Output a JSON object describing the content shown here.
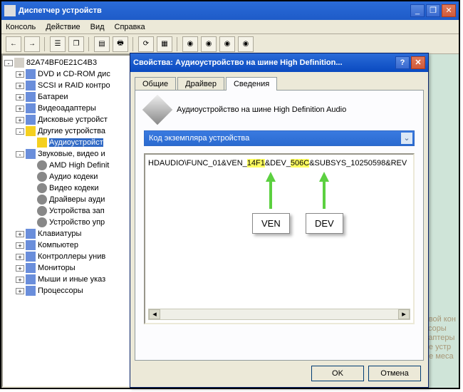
{
  "main": {
    "title": "Диспетчер устройств",
    "menu": [
      "Консоль",
      "Действие",
      "Вид",
      "Справка"
    ]
  },
  "tree": {
    "root": "82A74BF0E21C4B3",
    "items": [
      {
        "label": "DVD и CD-ROM дис",
        "cls": ""
      },
      {
        "label": "SCSI и RAID контро",
        "cls": ""
      },
      {
        "label": "Батареи",
        "cls": ""
      },
      {
        "label": "Видеоадаптеры",
        "cls": ""
      },
      {
        "label": "Дисковые устройст",
        "cls": ""
      },
      {
        "label": "Другие устройства",
        "cls": "warn",
        "open": true,
        "children": [
          {
            "label": "Аудиоустройст",
            "cls": "warn",
            "sel": true
          }
        ]
      },
      {
        "label": "Звуковые, видео и",
        "cls": "",
        "open": true,
        "children": [
          {
            "label": "AMD High Definit",
            "cls": "audio"
          },
          {
            "label": "Аудио кодеки",
            "cls": "audio"
          },
          {
            "label": "Видео кодеки",
            "cls": "audio"
          },
          {
            "label": "Драйверы ауди",
            "cls": "audio"
          },
          {
            "label": "Устройства зап",
            "cls": "audio"
          },
          {
            "label": "Устройство упр",
            "cls": "audio"
          }
        ]
      },
      {
        "label": "Клавиатуры",
        "cls": ""
      },
      {
        "label": "Компьютер",
        "cls": ""
      },
      {
        "label": "Контроллеры унив",
        "cls": ""
      },
      {
        "label": "Мониторы",
        "cls": ""
      },
      {
        "label": "Мыши и иные указ",
        "cls": ""
      },
      {
        "label": "Процессоры",
        "cls": ""
      }
    ]
  },
  "dialog": {
    "title": "Свойства: Аудиоустройство на шине High Definition...",
    "tabs": [
      "Общие",
      "Драйвер",
      "Сведения"
    ],
    "active_tab": 2,
    "device_name": "Аудиоустройство на шине High Definition Audio",
    "combo": "Код экземпляра устройства",
    "hwid": {
      "pre": "HDAUDIO\\FUNC_01&VEN_",
      "ven": "14F1",
      "mid": "&DEV_",
      "dev": "506C",
      "post": "&SUBSYS_10250598&REV"
    },
    "annot_ven": "VEN",
    "annot_dev": "DEV",
    "ok": "OK",
    "cancel": "Отмена"
  },
  "cut": [
    "Сетевой кон",
    "оцессоры",
    "осадаптеры",
    "ковые устр",
    "терые меса"
  ]
}
